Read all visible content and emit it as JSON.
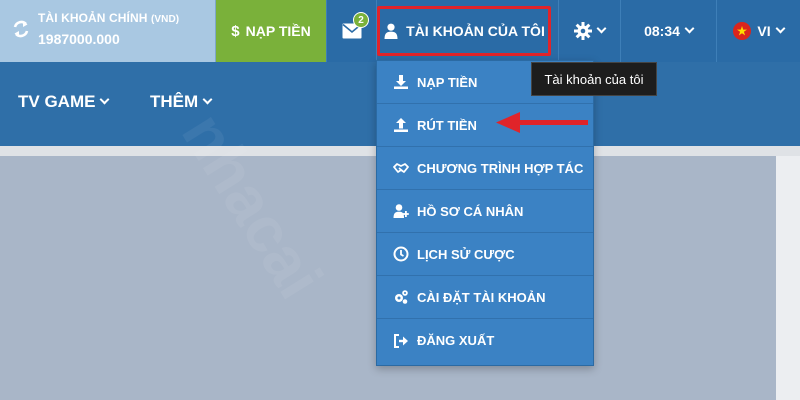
{
  "header": {
    "account_label": "TÀI KHOẢN CHÍNH",
    "account_currency": "(VND)",
    "balance": "1987000.000",
    "deposit_label": "NẠP TIỀN",
    "mail_badge": "2",
    "my_account_label": "TÀI KHOẢN CỦA TÔI",
    "time": "08:34",
    "language": "VI"
  },
  "nav": {
    "tv_game": "TV GAME",
    "more": "THÊM"
  },
  "tooltip": "Tài khoản của tôi",
  "watermark": "nhacai",
  "menu": {
    "items": [
      {
        "label": "NẠP TIỀN",
        "icon": "download-icon"
      },
      {
        "label": "RÚT TIỀN",
        "icon": "upload-icon"
      },
      {
        "label": "CHƯƠNG TRÌNH HỢP TÁC",
        "icon": "handshake-icon"
      },
      {
        "label": "HỒ SƠ CÁ NHÂN",
        "icon": "user-plus-icon"
      },
      {
        "label": "LỊCH SỬ CƯỢC",
        "icon": "clock-icon"
      },
      {
        "label": "CÀI ĐẶT TÀI KHOẢN",
        "icon": "cogs-icon"
      },
      {
        "label": "ĐĂNG XUẤT",
        "icon": "logout-icon"
      }
    ]
  },
  "colors": {
    "topbar": "#2a6ba6",
    "deposit": "#7ab13a",
    "highlight": "#e0242a",
    "menu": "#3b82c4"
  }
}
